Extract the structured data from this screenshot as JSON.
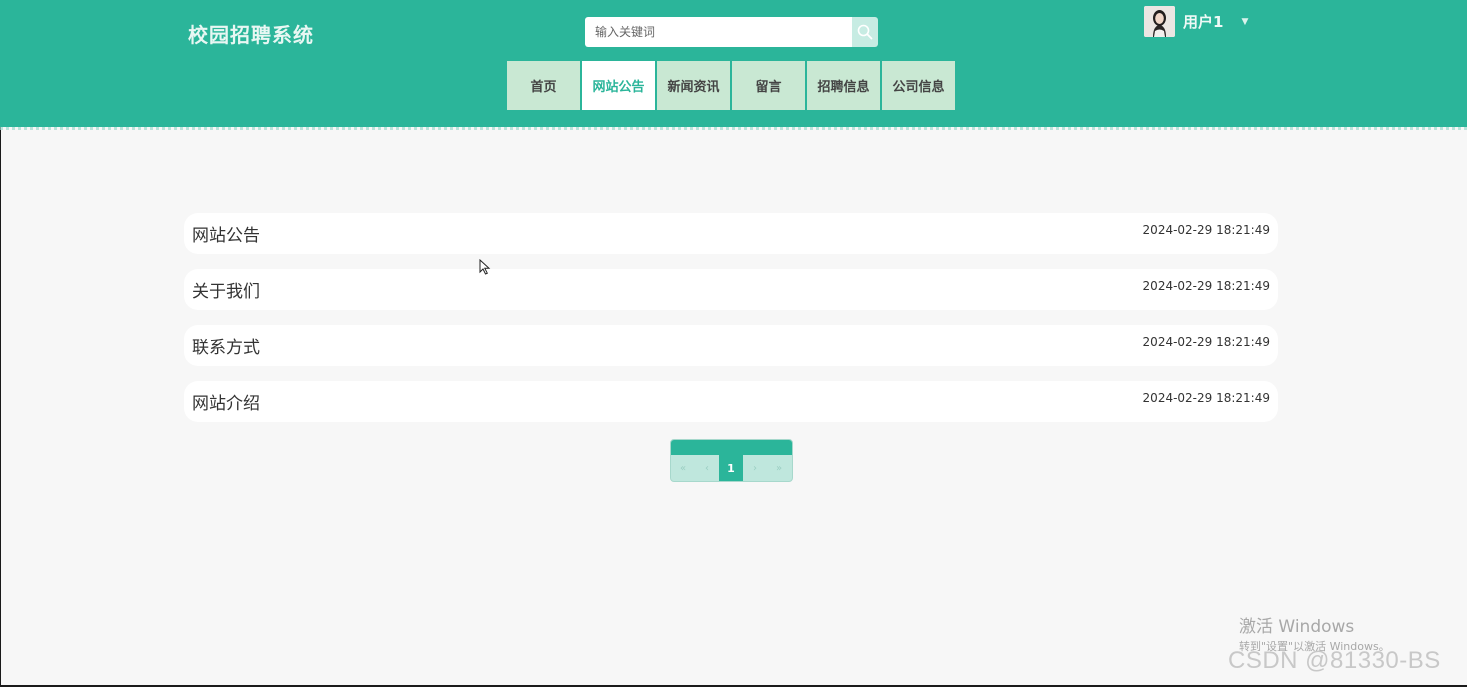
{
  "header": {
    "brand": "校园招聘系统",
    "search": {
      "placeholder": "输入关键词",
      "value": ""
    },
    "user": {
      "name": "用户1"
    }
  },
  "nav": {
    "items": [
      {
        "label": "首页",
        "active": false
      },
      {
        "label": "网站公告",
        "active": true
      },
      {
        "label": "新闻资讯",
        "active": false
      },
      {
        "label": "留言",
        "active": false
      },
      {
        "label": "招聘信息",
        "active": false
      },
      {
        "label": "公司信息",
        "active": false
      }
    ]
  },
  "notices": [
    {
      "title": "网站公告",
      "date": "2024-02-29 18:21:49"
    },
    {
      "title": "关于我们",
      "date": "2024-02-29 18:21:49"
    },
    {
      "title": "联系方式",
      "date": "2024-02-29 18:21:49"
    },
    {
      "title": "网站介绍",
      "date": "2024-02-29 18:21:49"
    }
  ],
  "pagination": {
    "first": "«",
    "prev": "‹",
    "current": "1",
    "next": "›",
    "last": "»"
  },
  "overlay": {
    "activate_title": "激活 Windows",
    "activate_sub": "转到\"设置\"以激活 Windows。",
    "csdn": "CSDN @81330-BS"
  },
  "colors": {
    "primary": "#2bb59a",
    "nav_bg": "#c9e8d3",
    "page_bg": "#f7f7f7"
  }
}
